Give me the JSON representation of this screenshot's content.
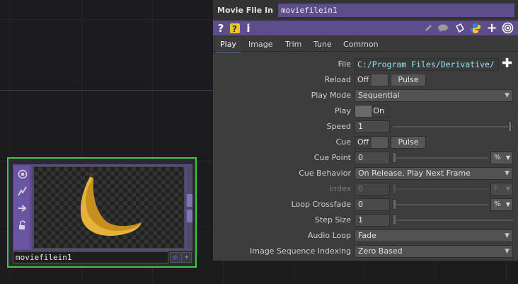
{
  "node": {
    "name": "moviefilein1",
    "sidebar_icons": [
      "viewer-active-icon",
      "cook-icon",
      "export-icon",
      "lock-icon"
    ]
  },
  "panel": {
    "op_type": "Movie File In",
    "op_name": "moviefilein1",
    "toolbar": {
      "help": "?",
      "info": "i",
      "icons": [
        "help-icon",
        "python-help-icon",
        "info-icon",
        "edit-icon",
        "comment-icon",
        "clone-icon",
        "python-icon",
        "add-icon",
        "viewer-icon"
      ]
    },
    "tabs": [
      "Play",
      "Image",
      "Trim",
      "Tune",
      "Common"
    ],
    "active_tab": "Play",
    "params": {
      "file": {
        "label": "File",
        "value": "C:/Program Files/Derivative/"
      },
      "reload": {
        "label": "Reload",
        "state": "Off",
        "pulse": "Pulse"
      },
      "play_mode": {
        "label": "Play Mode",
        "value": "Sequential"
      },
      "play": {
        "label": "Play",
        "state": "On"
      },
      "speed": {
        "label": "Speed",
        "value": "1"
      },
      "cue": {
        "label": "Cue",
        "state": "Off",
        "pulse": "Pulse"
      },
      "cue_point": {
        "label": "Cue Point",
        "value": "0",
        "unit": "%"
      },
      "cue_behavior": {
        "label": "Cue Behavior",
        "value": "On Release, Play Next Frame"
      },
      "index": {
        "label": "Index",
        "value": "0",
        "unit": "F"
      },
      "loop_crossfade": {
        "label": "Loop Crossfade",
        "value": "0",
        "unit": "%"
      },
      "step_size": {
        "label": "Step Size",
        "value": "1"
      },
      "audio_loop": {
        "label": "Audio Loop",
        "value": "Fade"
      },
      "image_sequence_indexing": {
        "label": "Image Sequence Indexing",
        "value": "Zero Based"
      }
    }
  },
  "colors": {
    "node_border": "#3ec84a",
    "op_purple": "#5e4d8b",
    "file_text": "#8fe3f0",
    "tab_underline": "#5b82c6"
  }
}
